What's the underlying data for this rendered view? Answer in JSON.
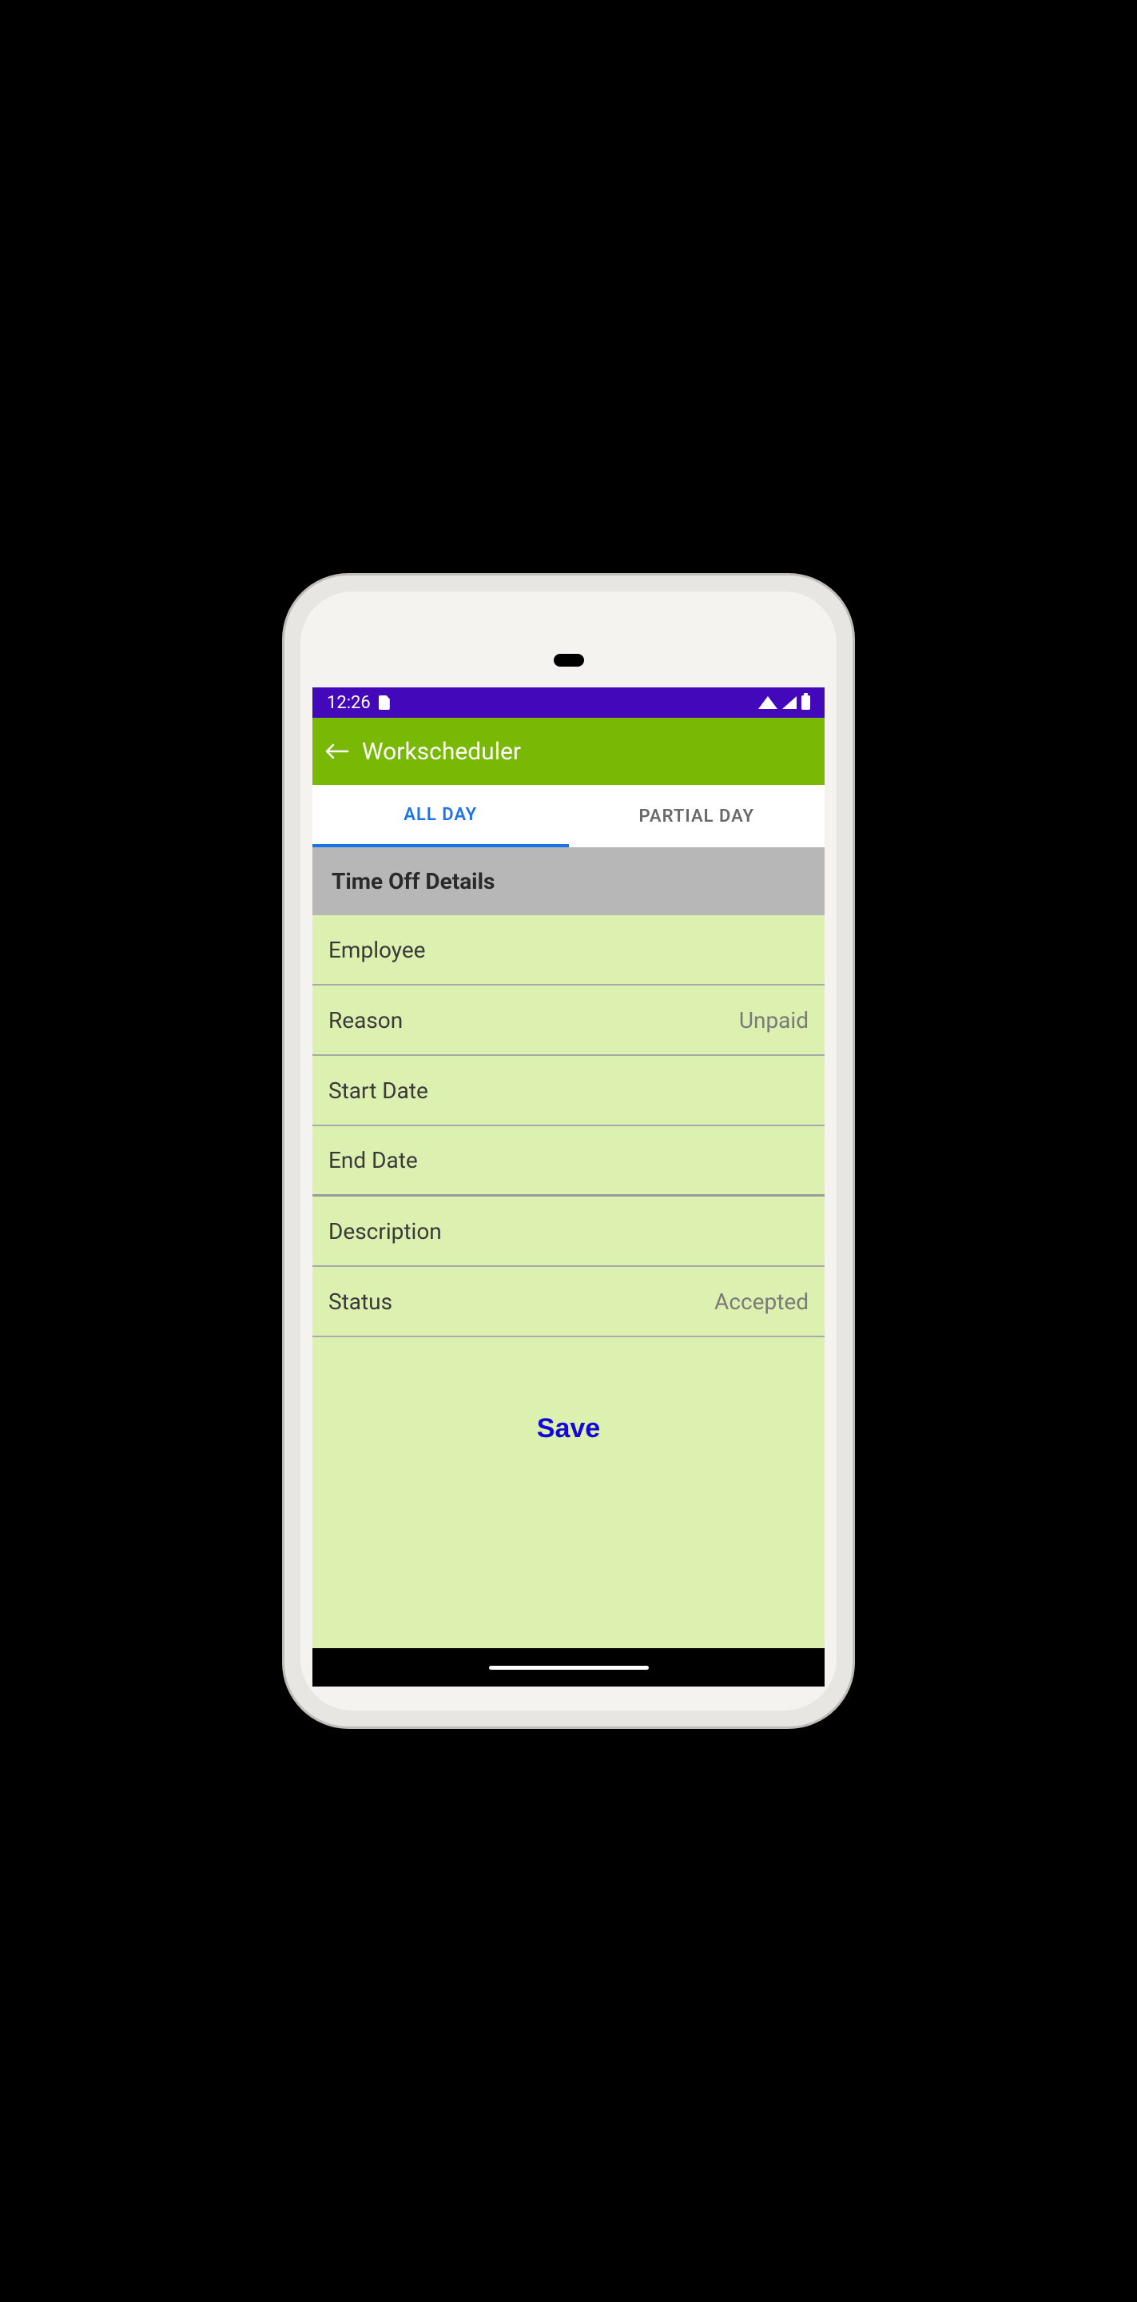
{
  "status_bar": {
    "time": "12:26"
  },
  "app_bar": {
    "title": "Workscheduler"
  },
  "tabs": {
    "all_day": "ALL DAY",
    "partial_day": "PARTIAL DAY"
  },
  "section": {
    "title": "Time Off Details"
  },
  "form": {
    "employee": {
      "label": "Employee",
      "value": ""
    },
    "reason": {
      "label": "Reason",
      "value": "Unpaid"
    },
    "start_date": {
      "label": "Start Date",
      "value": ""
    },
    "end_date": {
      "label": "End Date",
      "value": ""
    },
    "description": {
      "label": "Description",
      "value": ""
    },
    "status": {
      "label": "Status",
      "value": "Accepted"
    }
  },
  "buttons": {
    "save": "Save"
  }
}
